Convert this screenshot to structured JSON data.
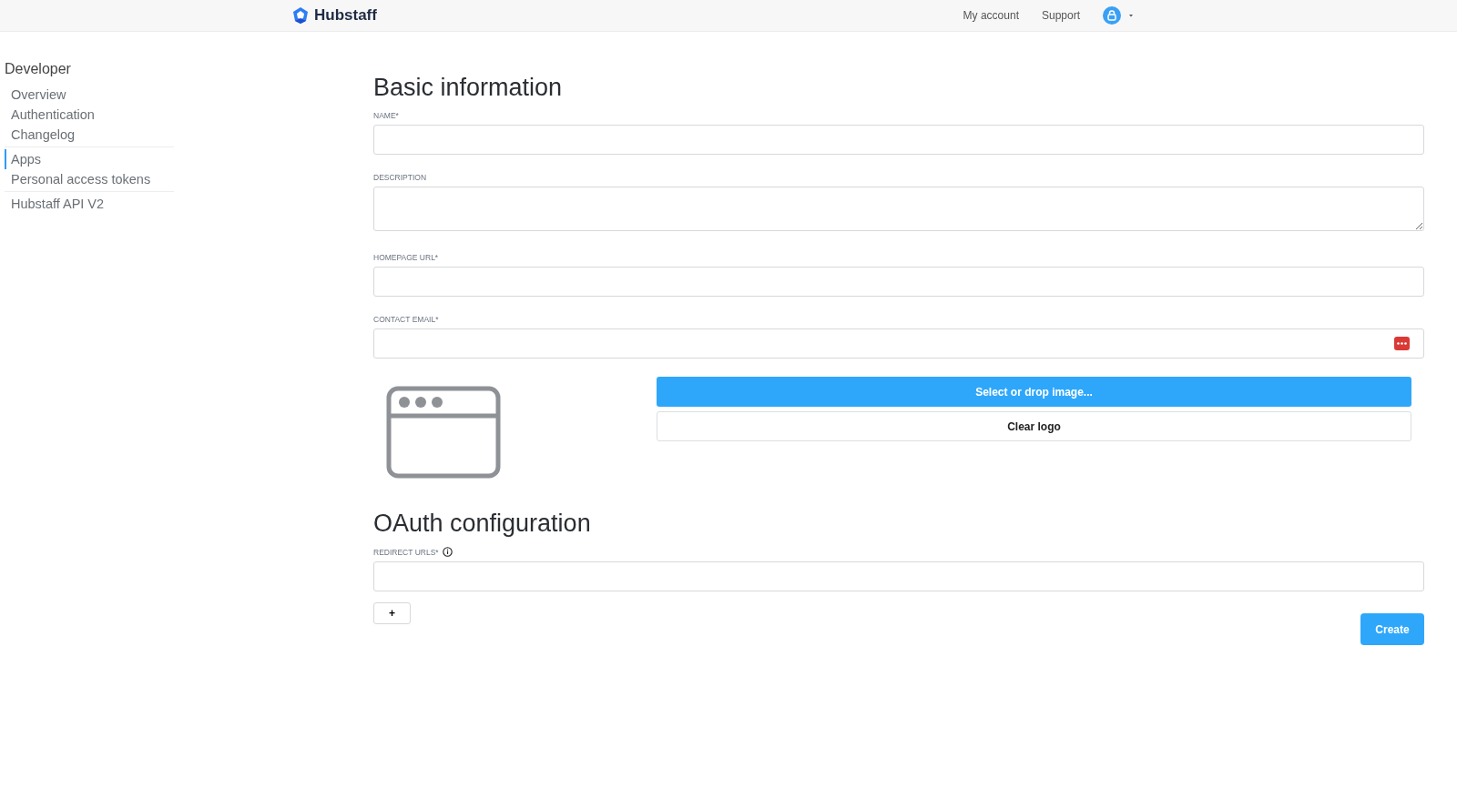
{
  "header": {
    "brand": "Hubstaff",
    "links": [
      "My account",
      "Support"
    ]
  },
  "sidebar": {
    "title": "Developer",
    "groups": [
      [
        {
          "label": "Overview",
          "selected": false
        },
        {
          "label": "Authentication",
          "selected": false
        },
        {
          "label": "Changelog",
          "selected": false
        }
      ],
      [
        {
          "label": "Apps",
          "selected": true
        },
        {
          "label": "Personal access tokens",
          "selected": false
        }
      ],
      [
        {
          "label": "Hubstaff API V2",
          "selected": false
        }
      ]
    ]
  },
  "basic": {
    "title": "Basic information",
    "fields": [
      {
        "label": "NAME*",
        "kind": "input"
      },
      {
        "label": "DESCRIPTION",
        "kind": "textarea"
      },
      {
        "label": "HOMEPAGE URL*",
        "kind": "input"
      },
      {
        "label": "CONTACT EMAIL*",
        "kind": "email"
      }
    ],
    "logo": {
      "select_button": "Select or drop image...",
      "clear_button": "Clear logo"
    }
  },
  "oauth": {
    "title": "OAuth configuration",
    "field_label": "REDIRECT URLS*",
    "add_button": "+"
  },
  "create_button": "Create"
}
